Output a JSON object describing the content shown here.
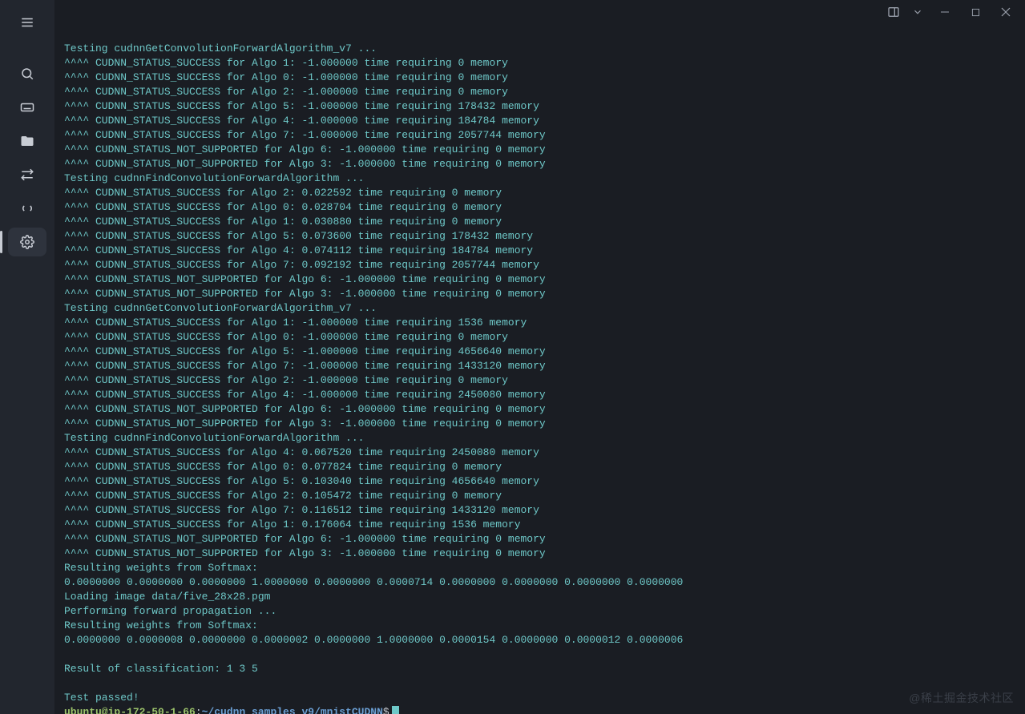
{
  "sidebar": {
    "items": [
      {
        "name": "menu-icon"
      },
      {
        "name": "search-icon"
      },
      {
        "name": "keyboard-icon"
      },
      {
        "name": "files-icon"
      },
      {
        "name": "transfer-icon"
      },
      {
        "name": "code-icon"
      },
      {
        "name": "settings-icon"
      }
    ]
  },
  "titlebar": {
    "panel": "panel-toggle-icon",
    "dropdown": "chevron-down-icon",
    "minimize": "minimize-icon",
    "maximize": "maximize-icon",
    "close": "close-icon"
  },
  "terminal": {
    "lines": [
      "",
      "Testing cudnnGetConvolutionForwardAlgorithm_v7 ...",
      "^^^^ CUDNN_STATUS_SUCCESS for Algo 1: -1.000000 time requiring 0 memory",
      "^^^^ CUDNN_STATUS_SUCCESS for Algo 0: -1.000000 time requiring 0 memory",
      "^^^^ CUDNN_STATUS_SUCCESS for Algo 2: -1.000000 time requiring 0 memory",
      "^^^^ CUDNN_STATUS_SUCCESS for Algo 5: -1.000000 time requiring 178432 memory",
      "^^^^ CUDNN_STATUS_SUCCESS for Algo 4: -1.000000 time requiring 184784 memory",
      "^^^^ CUDNN_STATUS_SUCCESS for Algo 7: -1.000000 time requiring 2057744 memory",
      "^^^^ CUDNN_STATUS_NOT_SUPPORTED for Algo 6: -1.000000 time requiring 0 memory",
      "^^^^ CUDNN_STATUS_NOT_SUPPORTED for Algo 3: -1.000000 time requiring 0 memory",
      "Testing cudnnFindConvolutionForwardAlgorithm ...",
      "^^^^ CUDNN_STATUS_SUCCESS for Algo 2: 0.022592 time requiring 0 memory",
      "^^^^ CUDNN_STATUS_SUCCESS for Algo 0: 0.028704 time requiring 0 memory",
      "^^^^ CUDNN_STATUS_SUCCESS for Algo 1: 0.030880 time requiring 0 memory",
      "^^^^ CUDNN_STATUS_SUCCESS for Algo 5: 0.073600 time requiring 178432 memory",
      "^^^^ CUDNN_STATUS_SUCCESS for Algo 4: 0.074112 time requiring 184784 memory",
      "^^^^ CUDNN_STATUS_SUCCESS for Algo 7: 0.092192 time requiring 2057744 memory",
      "^^^^ CUDNN_STATUS_NOT_SUPPORTED for Algo 6: -1.000000 time requiring 0 memory",
      "^^^^ CUDNN_STATUS_NOT_SUPPORTED for Algo 3: -1.000000 time requiring 0 memory",
      "Testing cudnnGetConvolutionForwardAlgorithm_v7 ...",
      "^^^^ CUDNN_STATUS_SUCCESS for Algo 1: -1.000000 time requiring 1536 memory",
      "^^^^ CUDNN_STATUS_SUCCESS for Algo 0: -1.000000 time requiring 0 memory",
      "^^^^ CUDNN_STATUS_SUCCESS for Algo 5: -1.000000 time requiring 4656640 memory",
      "^^^^ CUDNN_STATUS_SUCCESS for Algo 7: -1.000000 time requiring 1433120 memory",
      "^^^^ CUDNN_STATUS_SUCCESS for Algo 2: -1.000000 time requiring 0 memory",
      "^^^^ CUDNN_STATUS_SUCCESS for Algo 4: -1.000000 time requiring 2450080 memory",
      "^^^^ CUDNN_STATUS_NOT_SUPPORTED for Algo 6: -1.000000 time requiring 0 memory",
      "^^^^ CUDNN_STATUS_NOT_SUPPORTED for Algo 3: -1.000000 time requiring 0 memory",
      "Testing cudnnFindConvolutionForwardAlgorithm ...",
      "^^^^ CUDNN_STATUS_SUCCESS for Algo 4: 0.067520 time requiring 2450080 memory",
      "^^^^ CUDNN_STATUS_SUCCESS for Algo 0: 0.077824 time requiring 0 memory",
      "^^^^ CUDNN_STATUS_SUCCESS for Algo 5: 0.103040 time requiring 4656640 memory",
      "^^^^ CUDNN_STATUS_SUCCESS for Algo 2: 0.105472 time requiring 0 memory",
      "^^^^ CUDNN_STATUS_SUCCESS for Algo 7: 0.116512 time requiring 1433120 memory",
      "^^^^ CUDNN_STATUS_SUCCESS for Algo 1: 0.176064 time requiring 1536 memory",
      "^^^^ CUDNN_STATUS_NOT_SUPPORTED for Algo 6: -1.000000 time requiring 0 memory",
      "^^^^ CUDNN_STATUS_NOT_SUPPORTED for Algo 3: -1.000000 time requiring 0 memory",
      "Resulting weights from Softmax:",
      "0.0000000 0.0000000 0.0000000 1.0000000 0.0000000 0.0000714 0.0000000 0.0000000 0.0000000 0.0000000",
      "Loading image data/five_28x28.pgm",
      "Performing forward propagation ...",
      "Resulting weights from Softmax:",
      "0.0000000 0.0000008 0.0000000 0.0000002 0.0000000 1.0000000 0.0000154 0.0000000 0.0000012 0.0000006",
      "",
      "Result of classification: 1 3 5",
      "",
      "Test passed!"
    ],
    "prompt": {
      "user": "ubuntu@ip-172-50-1-66",
      "colon": ":",
      "path": "~/cudnn_samples_v9/mnistCUDNN",
      "dollar": "$"
    }
  },
  "watermark": "@稀土掘金技术社区"
}
